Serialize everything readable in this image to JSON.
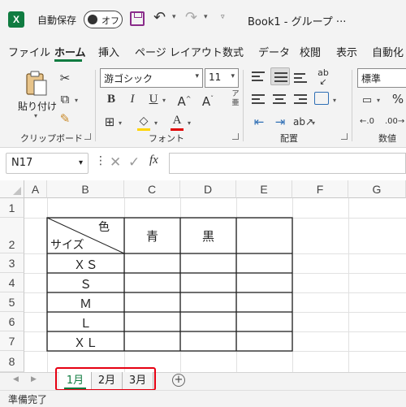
{
  "titlebar": {
    "app_logo": "X",
    "autosave_label": "自動保存",
    "autosave_toggle": "オフ",
    "book_title": "Book1 - グループ ···",
    "icons": [
      "excel-logo-icon",
      "save-icon",
      "undo-icon",
      "redo-icon",
      "customize-icon"
    ]
  },
  "ribbon_tabs": [
    "ファイル",
    "ホーム",
    "挿入",
    "ページ レイアウト",
    "数式",
    "データ",
    "校閲",
    "表示",
    "自動化"
  ],
  "active_tab": "ホーム",
  "ribbon": {
    "clipboard": {
      "paste_label": "貼り付け",
      "group_label": "クリップボード"
    },
    "font": {
      "font_name": "游ゴシック",
      "font_size": "11",
      "group_label": "フォント",
      "bold": "B",
      "italic": "I",
      "underline": "U",
      "grow": "A^",
      "shrink": "Aˇ",
      "phonetic": "ア亜"
    },
    "alignment": {
      "group_label": "配置"
    },
    "number": {
      "format": "標準",
      "group_label": "数値",
      "percent": "%"
    }
  },
  "formula_bar": {
    "name_box": "N17",
    "fx_label": "fx",
    "value": ""
  },
  "grid": {
    "columns": [
      "A",
      "B",
      "C",
      "D",
      "E",
      "F",
      "G"
    ],
    "rows": [
      "1",
      "2",
      "3",
      "4",
      "5",
      "6",
      "7",
      "8"
    ],
    "header_diag_top": "色",
    "header_diag_bottom": "サイズ",
    "color_headers": [
      "青",
      "黒",
      ""
    ],
    "sizes": [
      "ＸＳ",
      "Ｓ",
      "Ｍ",
      "Ｌ",
      "ＸＬ"
    ]
  },
  "sheets": {
    "tabs": [
      "1月",
      "2月",
      "3月"
    ],
    "active": "1月",
    "add_label": "+"
  },
  "status": {
    "text": "準備完了"
  },
  "colors": {
    "excel_green": "#107c41",
    "highlight_red": "#e60012",
    "save_purple": "#8a2b8a",
    "font_red": "#e00000"
  }
}
